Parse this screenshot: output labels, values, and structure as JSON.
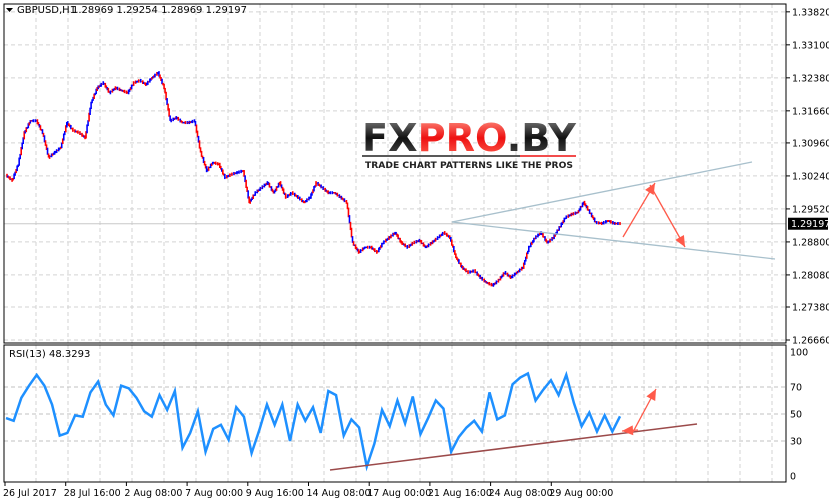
{
  "header": {
    "symbol_label": "GBPUSD,H1",
    "ohlc": "1.28969 1.29254 1.28969 1.29197",
    "menu_icon": "triangle-down-icon"
  },
  "logo": {
    "brand": "FXPRO.BY",
    "tagline": "TRADE CHART PATTERNS LIKE THE PROS"
  },
  "colors": {
    "bull_bar": "#0000ff",
    "bear_bar": "#ff0000",
    "rsi_line": "#1e90ff",
    "trendline": "#a8c0cc",
    "rsi_trendline": "#9b4a4a",
    "arrow": "#ff5a4a",
    "grid": "#d3d3d3"
  },
  "chart_data": [
    {
      "type": "line",
      "title": "GBPUSD,H1",
      "ylim": [
        1.2666,
        1.3382
      ],
      "y_ticks": [
        "1.33820",
        "1.33100",
        "1.32380",
        "1.31660",
        "1.30960",
        "1.30240",
        "1.29520",
        "1.28800",
        "1.28080",
        "1.27380",
        "1.26660"
      ],
      "x_ticks": [
        "26 Jul 2017",
        "28 Jul 16:00",
        "2 Aug 08:00",
        "7 Aug 00:00",
        "9 Aug 16:00",
        "14 Aug 08:00",
        "17 Aug 00:00",
        "21 Aug 16:00",
        "24 Aug 08:00",
        "29 Aug 00:00"
      ],
      "current_price": "1.29197",
      "grid": true,
      "close": [
        1.3025,
        1.3014,
        1.3049,
        1.3118,
        1.3144,
        1.3144,
        1.3118,
        1.3064,
        1.3075,
        1.3086,
        1.314,
        1.3123,
        1.3118,
        1.3107,
        1.3184,
        1.3216,
        1.3227,
        1.3205,
        1.3216,
        1.321,
        1.3205,
        1.3227,
        1.3232,
        1.3223,
        1.3238,
        1.3249,
        1.3216,
        1.3144,
        1.3151,
        1.314,
        1.314,
        1.3144,
        1.3075,
        1.3035,
        1.3053,
        1.3049,
        1.302,
        1.3027,
        1.3031,
        1.3035,
        1.2966,
        1.2987,
        1.2998,
        1.3009,
        1.2987,
        1.3009,
        1.2977,
        1.2987,
        1.2977,
        1.2966,
        1.2977,
        1.3009,
        1.2998,
        1.2987,
        1.2987,
        1.2977,
        1.2966,
        1.2878,
        1.2857,
        1.2868,
        1.2868,
        1.2857,
        1.2878,
        1.2889,
        1.29,
        1.2878,
        1.2868,
        1.2878,
        1.2883,
        1.2868,
        1.2878,
        1.2889,
        1.29,
        1.2889,
        1.2846,
        1.2824,
        1.2813,
        1.2817,
        1.2802,
        1.2791,
        1.2785,
        1.2796,
        1.2813,
        1.2802,
        1.2813,
        1.2824,
        1.2868,
        1.2889,
        1.29,
        1.2878,
        1.2889,
        1.2911,
        1.2933,
        1.294,
        1.2944,
        1.2966,
        1.2944,
        1.2922,
        1.292,
        1.2926,
        1.292,
        1.29197
      ]
    },
    {
      "type": "line",
      "title": "RSI(13) 48.3293",
      "ylim": [
        0,
        100
      ],
      "y_ticks": [
        "100",
        "70",
        "50",
        "30",
        "0"
      ],
      "levels": [
        70,
        50,
        30
      ],
      "grid": true,
      "values": [
        47,
        45,
        62,
        71,
        79,
        71,
        57,
        34,
        36,
        49,
        48,
        66,
        74,
        57,
        49,
        71,
        69,
        62,
        52,
        48,
        64,
        53,
        67,
        25,
        36,
        52,
        22,
        39,
        42,
        31,
        55,
        48,
        21,
        38,
        57,
        42,
        57,
        30,
        57,
        45,
        55,
        36,
        67,
        64,
        34,
        46,
        40,
        11,
        28,
        53,
        41,
        60,
        43,
        63,
        35,
        47,
        60,
        54,
        22,
        33,
        40,
        45,
        37,
        66,
        46,
        49,
        72,
        77,
        80,
        60,
        68,
        75,
        64,
        79,
        58,
        41,
        51,
        37,
        49,
        37,
        48.33
      ]
    }
  ]
}
